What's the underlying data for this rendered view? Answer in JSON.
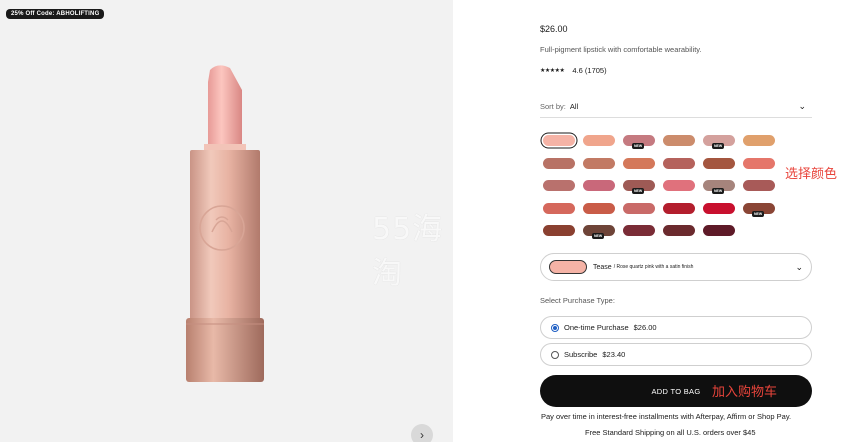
{
  "promo": {
    "badge": "25% Off Code: ABHOLIFTING"
  },
  "product": {
    "price": "$26.00",
    "description": "Full-pigment lipstick with comfortable wearability.",
    "rating_stars": "★★★★★",
    "rating": "4.6 (1705)"
  },
  "watermark": "55海淘",
  "sort": {
    "label": "Sort by:",
    "value": "All"
  },
  "swatches": {
    "colors": [
      "#f5b3a6",
      "#f0a58c",
      "#c57a80",
      "#cc8c6c",
      "#d4a19d",
      "#e0a06c",
      "#b87265",
      "#c27a64",
      "#d4785a",
      "#b5625c",
      "#a4563f",
      "#e5766a",
      "#b9716d",
      "#c9687a",
      "#9e5a55",
      "#e0717c",
      "#a6847c",
      "#a85a58",
      "#d5685c",
      "#c95c48",
      "#c96a68",
      "#b31e2d",
      "#c8102e",
      "#8a4535",
      "#8a4030",
      "#6e4438",
      "#7a2c36",
      "#6b2a2e",
      "#5e1a28"
    ],
    "new_tag": "NEW",
    "note": "选择颜色"
  },
  "shade": {
    "name": "Tease",
    "detail": " / Rose quartz pink with a satin finish",
    "color": "#f5b3a6"
  },
  "purchase": {
    "label": "Select Purchase Type:",
    "one_time_label": "One-time Purchase",
    "one_time_price": "$26.00",
    "subscribe_label": "Subscribe",
    "subscribe_price": "$23.40"
  },
  "cta": {
    "label": "ADD TO BAG",
    "note": "加入购物车"
  },
  "pay_info": "Pay over time in interest-free installments with Afterpay, Affirm or Shop Pay.",
  "ship_info": "Free Standard Shipping on all U.S. orders over $45"
}
